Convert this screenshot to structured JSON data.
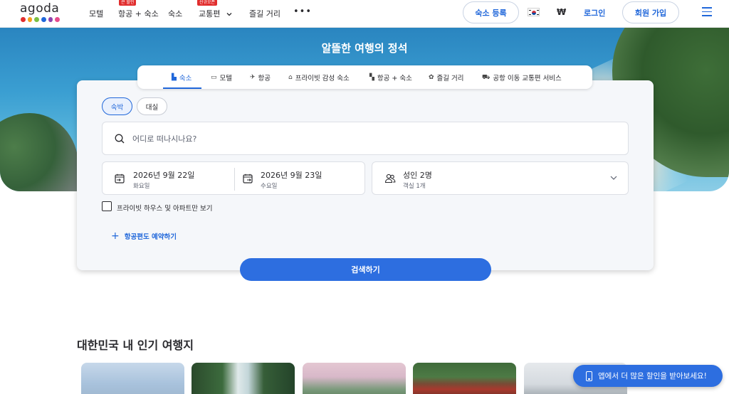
{
  "header": {
    "logo": "agoda",
    "logo_colors": [
      "#e12d2d",
      "#f4a11d",
      "#7bc043",
      "#2067da",
      "#8e44ad",
      "#e74c8b"
    ],
    "nav": [
      {
        "label": "모텔",
        "badge": ""
      },
      {
        "label": "항공 + 숙소",
        "badge": "큰 할인"
      },
      {
        "label": "숙소",
        "badge": ""
      },
      {
        "label": "교통편",
        "badge": "신규오픈"
      },
      {
        "label": "즐길 거리",
        "badge": ""
      }
    ],
    "more": "•••",
    "list_property": "숙소 등록",
    "currency": "₩",
    "login": "로그인",
    "signup": "회원 가입"
  },
  "hero": {
    "title": "알뜰한 여행의 정석"
  },
  "tabs": [
    {
      "label": "숙소",
      "icon": "hotel-icon"
    },
    {
      "label": "모텔",
      "icon": "bed-icon"
    },
    {
      "label": "항공",
      "icon": "plane-icon"
    },
    {
      "label": "프라이빗 감성 숙소",
      "icon": "house-icon"
    },
    {
      "label": "항공 + 숙소",
      "icon": "package-icon"
    },
    {
      "label": "즐길 거리",
      "icon": "activity-icon"
    },
    {
      "label": "공항 이동 교통편 서비스",
      "icon": "car-icon"
    }
  ],
  "search": {
    "stay_type": [
      "숙박",
      "대실"
    ],
    "placeholder": "어디로 떠나시나요?",
    "checkin": {
      "date": "2026년 9월 22일",
      "day": "화요일"
    },
    "checkout": {
      "date": "2026년 9월 23일",
      "day": "수요일"
    },
    "guests": {
      "main": "성인 2명",
      "sub": "객실 1개"
    },
    "private_only_label": "프라이빗 하우스 및 아파트만 보기",
    "add_flight": "항공편도 예약하기",
    "search_button": "검색하기"
  },
  "popular": {
    "title": "대한민국 내 인기 여행지"
  },
  "app_banner": "앱에서 더 많은 할인을 받아보세요!",
  "colors": {
    "accent": "#2067da",
    "button": "#2d6ee0",
    "badge": "#e12d2d"
  }
}
